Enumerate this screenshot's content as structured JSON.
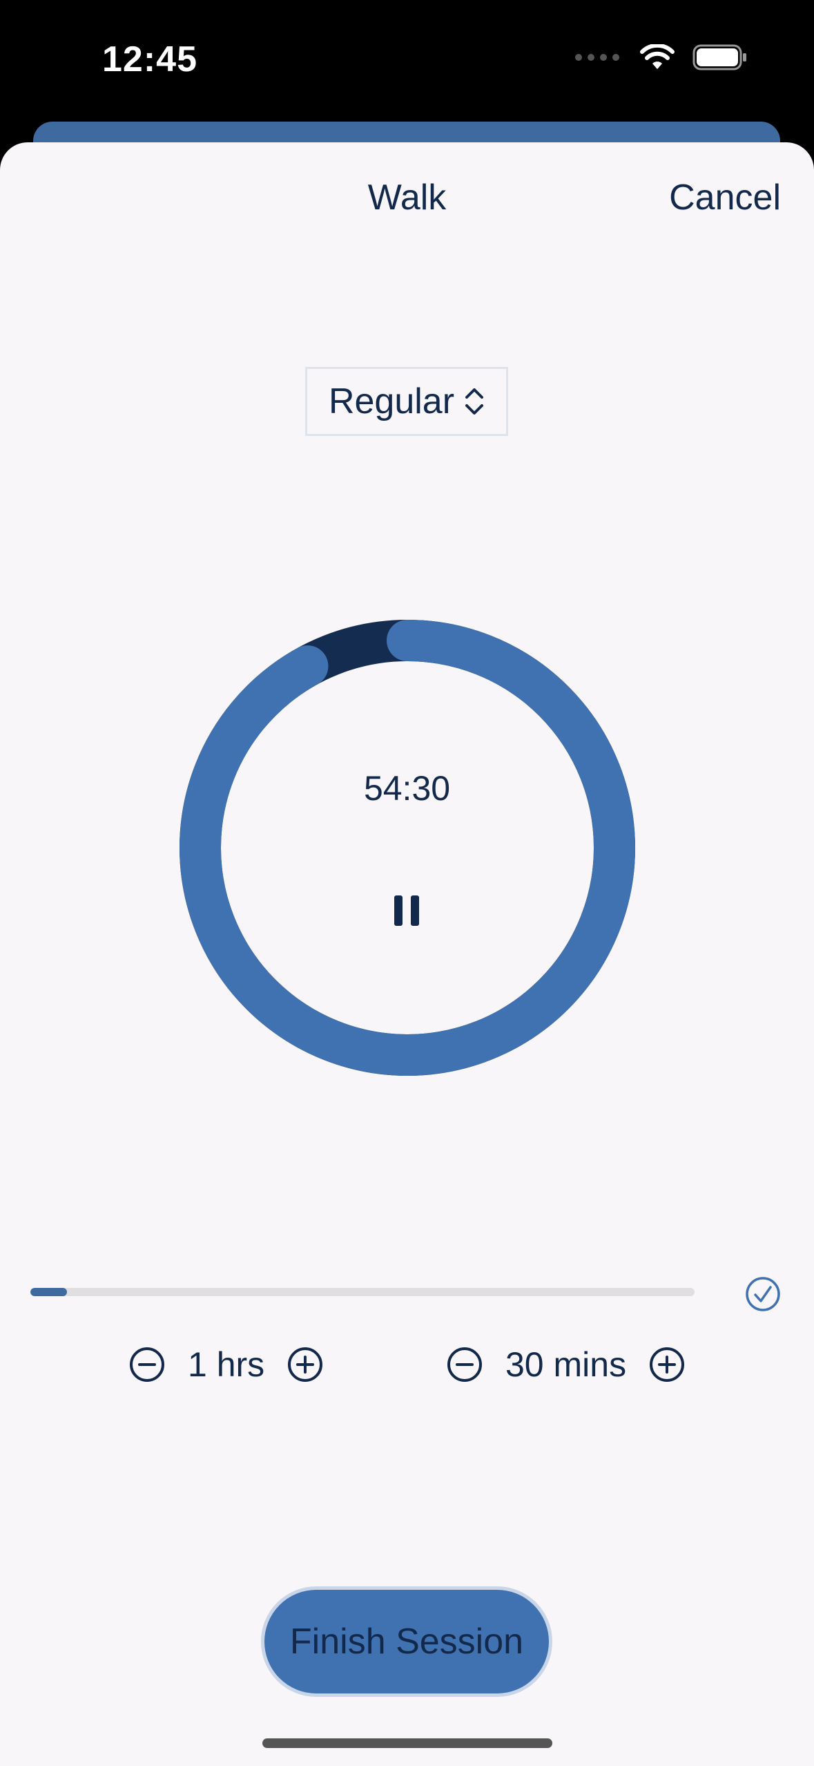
{
  "status_bar": {
    "time": "12:45"
  },
  "nav": {
    "title": "Walk",
    "cancel_label": "Cancel"
  },
  "mode_picker": {
    "selected": "Regular"
  },
  "timer": {
    "display": "54:30",
    "progress_fraction": 0.92
  },
  "goal_progress": {
    "fraction": 0.055
  },
  "steppers": {
    "hours": {
      "value": "1 hrs"
    },
    "minutes": {
      "value": "30 mins"
    }
  },
  "actions": {
    "finish_label": "Finish Session"
  },
  "colors": {
    "accent": "#4071b0",
    "accent_dark": "#13294b",
    "ring_track": "#142c50",
    "background": "#f8f6f8"
  },
  "icons": {
    "picker": "chevron-up-down-icon",
    "pause": "pause-icon",
    "complete": "checkmark-circle-icon",
    "decrement": "minus-circle-icon",
    "increment": "plus-circle-icon",
    "wifi": "wifi-icon",
    "battery": "battery-icon"
  }
}
